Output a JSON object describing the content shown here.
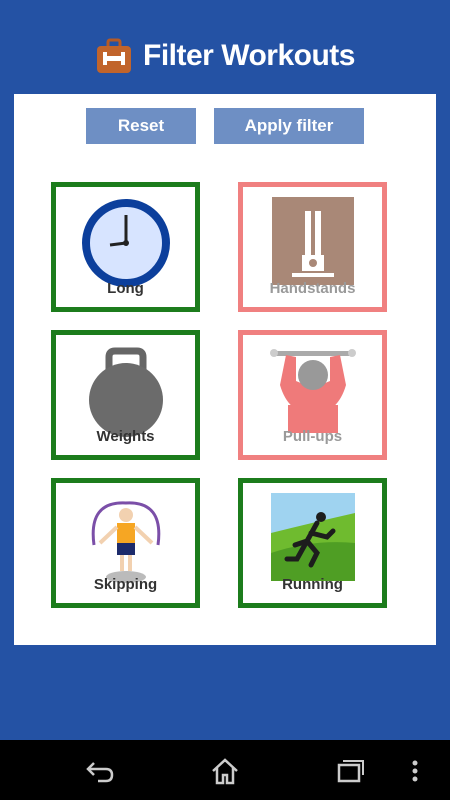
{
  "header": {
    "title": "Filter Workouts"
  },
  "toolbar": {
    "reset_label": "Reset",
    "apply_label": "Apply filter"
  },
  "workouts": [
    {
      "label": "Long",
      "selected": true
    },
    {
      "label": "Handstands",
      "selected": false
    },
    {
      "label": "Weights",
      "selected": true
    },
    {
      "label": "Pull-ups",
      "selected": false
    },
    {
      "label": "Skipping",
      "selected": true
    },
    {
      "label": "Running",
      "selected": true
    }
  ],
  "colors": {
    "background": "#2452a4",
    "selected_border": "#1c7c1c",
    "unselected_border": "#f08080",
    "button": "#6e8fc4"
  }
}
